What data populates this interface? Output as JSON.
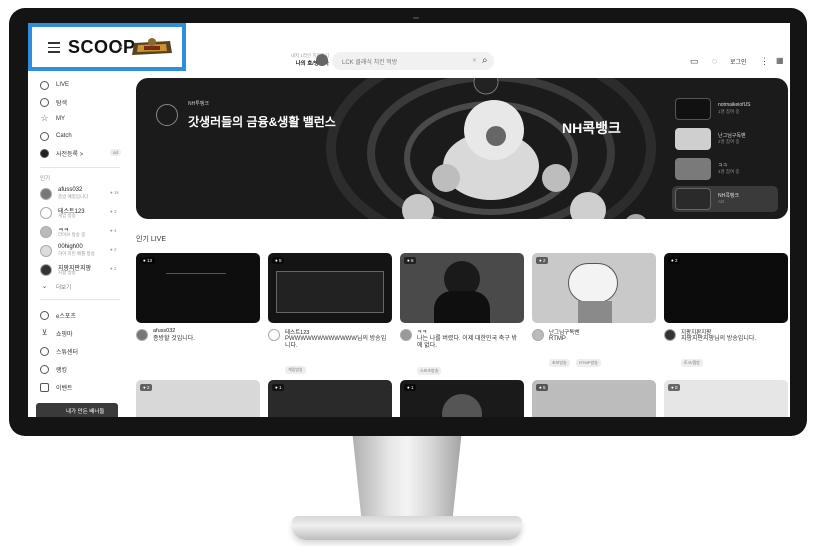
{
  "header": {
    "logo_text": "SCOOP",
    "logo_separator": "×",
    "game_logo_icon": "game-crest-logo",
    "streamer_sub": "내지 1라인 지원하기",
    "streamer_name": "나의 호/방송국",
    "search_placeholder": "LCK 클래식 치킨 먹방",
    "login_label": "로그인",
    "icons": [
      "menu-icon",
      "search-icon",
      "video-icon",
      "bell-icon",
      "more-icon",
      "grid-icon"
    ]
  },
  "sidebar": {
    "items": [
      {
        "label": "LIVE",
        "icon": "live-icon"
      },
      {
        "label": "탐색",
        "icon": "explore-icon"
      },
      {
        "label": "MY",
        "icon": "star-icon"
      },
      {
        "label": "Catch",
        "icon": "catch-icon"
      },
      {
        "label": "사전등록 >",
        "icon": "register-icon",
        "badge": "ad"
      }
    ],
    "favorites_title": "인기",
    "favorites": [
      {
        "name": "afuss032",
        "sub": "종방 예정입니다",
        "count": "● 1k"
      },
      {
        "name": "테스트123",
        "sub": "게임 방송",
        "count": "● 3"
      },
      {
        "name": "ㅋㅋ",
        "sub": "라이브 방송 중",
        "count": "● 4"
      },
      {
        "name": "00high00",
        "sub": "하이 치킨 배틀 방송",
        "count": "● 2"
      },
      {
        "name": "지팡지판지팡",
        "sub": "지팡 방송",
        "count": "● 2"
      }
    ],
    "more_label": "더보기",
    "bottom_items": [
      {
        "label": "e스포츠",
        "icon": "esports-icon"
      },
      {
        "label": "쇼핑마",
        "icon": "cart-icon"
      },
      {
        "label": "스튜센터",
        "icon": "studio-icon"
      },
      {
        "label": "랭킹",
        "icon": "trophy-icon"
      },
      {
        "label": "이벤트",
        "icon": "gift-icon"
      }
    ],
    "banner_label": "내가 만든 배너들"
  },
  "hero": {
    "tag": "NH투뱅크",
    "title": "갓생러들의 금융&생활 밸런스",
    "ribbon": "NH콕뱅크",
    "list": [
      {
        "title": "notmaikeiofUS",
        "sub": "1명 참여 중"
      },
      {
        "title": "난그님구독밴",
        "sub": "2명 참여 중"
      },
      {
        "title": "ㅋㅋ",
        "sub": "4명 참여 중"
      },
      {
        "title": "NH콕뱅크",
        "sub": "AD"
      }
    ]
  },
  "popular": {
    "title": "인기 LIVE",
    "cards": [
      {
        "viewers": "● 13",
        "name": "afuss032",
        "title": "종방할 것입니다.",
        "chips": []
      },
      {
        "viewers": "● 5",
        "name": "테스트123",
        "title": "PWWWWWWWWWWWW님의 방송입니다.",
        "chips": [
          "게임방송"
        ]
      },
      {
        "viewers": "● 6",
        "name": "ㅋㅋ",
        "title": "나는 나를 버렸다. 이제 대한민국 축구 밖에 없다.",
        "chips": [
          "스포츠방송"
        ]
      },
      {
        "viewers": "● 2",
        "name": "난그님구독밴",
        "title": "RTMP",
        "chips": [
          "초보방송",
          "RTMP방송"
        ]
      },
      {
        "viewers": "● 2",
        "name": "지팡지판지팡",
        "title": "지팡지판지팡님의 방송입니다.",
        "chips": [
          "토크/캠방"
        ]
      }
    ],
    "row2_viewers": [
      "● 2",
      "● 1",
      "● 1",
      "● 5",
      "● 0"
    ]
  }
}
